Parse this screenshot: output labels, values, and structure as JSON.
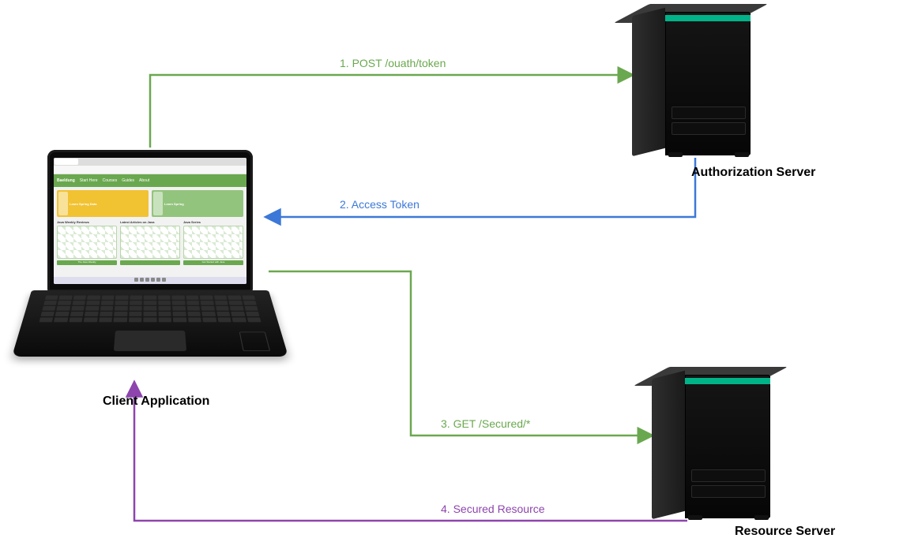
{
  "nodes": {
    "client": {
      "label": "Client Application"
    },
    "authServer": {
      "label": "Authorization Server"
    },
    "resServer": {
      "label": "Resource Server"
    }
  },
  "arrows": {
    "a1": {
      "label": "1. POST /ouath/token",
      "from": "client",
      "to": "authServer",
      "color": "#6aa84f"
    },
    "a2": {
      "label": "2. Access Token",
      "from": "authServer",
      "to": "client",
      "color": "#3c78d8"
    },
    "a3": {
      "label": "3. GET /Secured/*",
      "from": "client",
      "to": "resServer",
      "color": "#6aa84f"
    },
    "a4": {
      "label": "4. Secured Resource",
      "from": "resServer",
      "to": "client",
      "color": "#8e44ad"
    }
  },
  "laptopScreen": {
    "siteName": "Baeldung",
    "nav": [
      "Start Here",
      "Courses",
      "Guides",
      "About"
    ],
    "bannerLeft": "Learn Spring Data",
    "bannerRight": "Learn Spring",
    "col1": "Java Weekly Reviews",
    "col2": "Latest Articles on Java",
    "col3": "Java Series",
    "foot1": "The Java Weekly",
    "foot3": "Get Started with Java"
  },
  "colors": {
    "green": "#6aa84f",
    "blue": "#3c78d8",
    "purple": "#8e44ad",
    "hpeAccent": "#00b388"
  }
}
